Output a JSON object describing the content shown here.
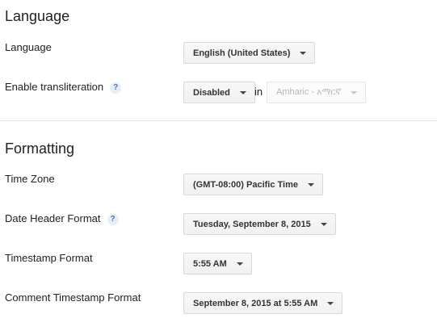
{
  "language_section": {
    "title": "Language",
    "language": {
      "label": "Language",
      "value": "English (United States)"
    },
    "transliteration": {
      "label": "Enable transliteration",
      "help": "?",
      "value": "Disabled",
      "connector": "in",
      "language_value": "Amharic - አማርኛ"
    }
  },
  "formatting_section": {
    "title": "Formatting",
    "time_zone": {
      "label": "Time Zone",
      "value": "(GMT-08:00) Pacific Time"
    },
    "date_header_format": {
      "label": "Date Header Format",
      "help": "?",
      "value": "Tuesday, September 8, 2015"
    },
    "timestamp_format": {
      "label": "Timestamp Format",
      "value": "5:55 AM"
    },
    "comment_timestamp_format": {
      "label": "Comment Timestamp Format",
      "value": "September 8, 2015 at 5:55 AM"
    }
  }
}
